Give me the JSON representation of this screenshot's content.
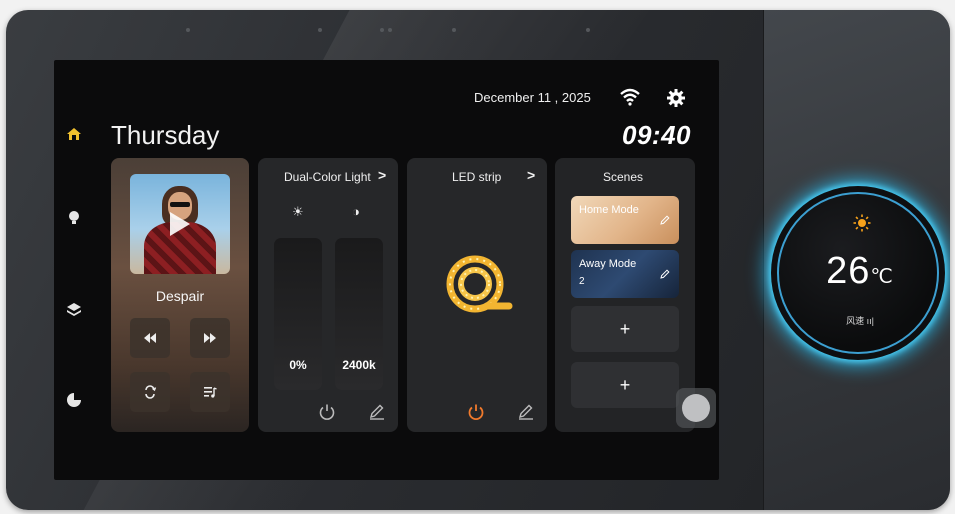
{
  "status_bar": {
    "date": "December 11 , 2025",
    "wifi_icon": "wifi-icon",
    "settings_icon": "gear-icon"
  },
  "header": {
    "day": "Thursday",
    "time": "09:40"
  },
  "nav": {
    "items": [
      {
        "icon": "home-icon",
        "active": true
      },
      {
        "icon": "bulb-icon",
        "active": false
      },
      {
        "icon": "layers-icon",
        "active": false
      },
      {
        "icon": "pie-icon",
        "active": false
      }
    ]
  },
  "music": {
    "song": "Despair",
    "controls": [
      "previous-icon",
      "next-icon",
      "repeat-icon",
      "playlist-icon"
    ]
  },
  "dual_light": {
    "title": "Dual-Color Light",
    "arrow": ">",
    "brightness": "0%",
    "color_temp": "2400k"
  },
  "led_strip": {
    "title": "LED strip",
    "arrow": ">",
    "power_color": "#f07a2c"
  },
  "scenes": {
    "title": "Scenes",
    "items": [
      {
        "label": "Home Mode",
        "sub": ""
      },
      {
        "label": "Away Mode",
        "sub": "2"
      }
    ],
    "add_label": "+"
  },
  "thermostat": {
    "temp": "26",
    "unit": "℃",
    "fan_label": "风速 ıı|",
    "glow_color": "#28c8ff"
  }
}
